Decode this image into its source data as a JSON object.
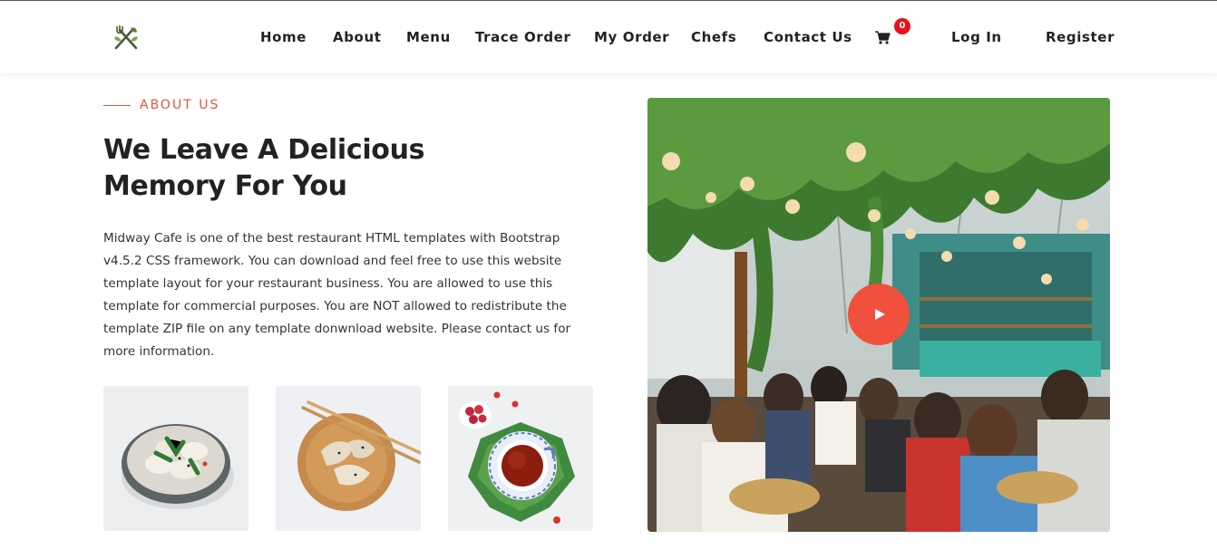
{
  "nav": {
    "logo_icon": "fork-knife-leaf-icon",
    "links": [
      "Home",
      "About",
      "Menu",
      "Trace Order",
      "My Order",
      "Chefs",
      "Contact Us"
    ],
    "cart_icon": "shopping-cart-icon",
    "cart_count": "0",
    "login_label": "Log In",
    "register_label": "Register"
  },
  "about": {
    "eyebrow": "ABOUT US",
    "heading_lines": [
      "We Leave A Delicious",
      "Memory For You"
    ],
    "body_lines": [
      "Midway Cafe is one of the best restaurant HTML templates with Bootstrap",
      "v4.5.2 CSS framework. You can download and feel free to use this website",
      "template layout for your restaurant business. You are allowed to use this",
      "template for commercial purposes. You are NOT allowed to redistribute the",
      "template ZIP file on any template donwnload website. Please contact us for",
      "more information."
    ],
    "gallery": [
      "dumplings-bowl-image",
      "dumplings-wooden-plate-image",
      "tea-cup-image"
    ]
  },
  "video": {
    "image": "restaurant-interior-photo",
    "play_icon": "play-icon"
  },
  "colors": {
    "accent": "#f1503f",
    "badge": "#e8101a",
    "text": "#222222"
  }
}
